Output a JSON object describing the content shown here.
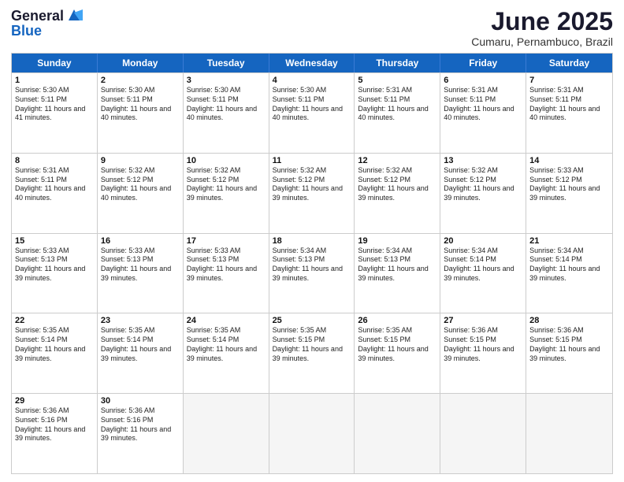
{
  "logo": {
    "text_general": "General",
    "text_blue": "Blue"
  },
  "title": "June 2025",
  "location": "Cumaru, Pernambuco, Brazil",
  "days_of_week": [
    "Sunday",
    "Monday",
    "Tuesday",
    "Wednesday",
    "Thursday",
    "Friday",
    "Saturday"
  ],
  "weeks": [
    [
      {
        "day": "1",
        "sunrise": "5:30 AM",
        "sunset": "5:11 PM",
        "daylight": "11 hours and 41 minutes."
      },
      {
        "day": "2",
        "sunrise": "5:30 AM",
        "sunset": "5:11 PM",
        "daylight": "11 hours and 40 minutes."
      },
      {
        "day": "3",
        "sunrise": "5:30 AM",
        "sunset": "5:11 PM",
        "daylight": "11 hours and 40 minutes."
      },
      {
        "day": "4",
        "sunrise": "5:30 AM",
        "sunset": "5:11 PM",
        "daylight": "11 hours and 40 minutes."
      },
      {
        "day": "5",
        "sunrise": "5:31 AM",
        "sunset": "5:11 PM",
        "daylight": "11 hours and 40 minutes."
      },
      {
        "day": "6",
        "sunrise": "5:31 AM",
        "sunset": "5:11 PM",
        "daylight": "11 hours and 40 minutes."
      },
      {
        "day": "7",
        "sunrise": "5:31 AM",
        "sunset": "5:11 PM",
        "daylight": "11 hours and 40 minutes."
      }
    ],
    [
      {
        "day": "8",
        "sunrise": "5:31 AM",
        "sunset": "5:11 PM",
        "daylight": "11 hours and 40 minutes."
      },
      {
        "day": "9",
        "sunrise": "5:32 AM",
        "sunset": "5:12 PM",
        "daylight": "11 hours and 40 minutes."
      },
      {
        "day": "10",
        "sunrise": "5:32 AM",
        "sunset": "5:12 PM",
        "daylight": "11 hours and 39 minutes."
      },
      {
        "day": "11",
        "sunrise": "5:32 AM",
        "sunset": "5:12 PM",
        "daylight": "11 hours and 39 minutes."
      },
      {
        "day": "12",
        "sunrise": "5:32 AM",
        "sunset": "5:12 PM",
        "daylight": "11 hours and 39 minutes."
      },
      {
        "day": "13",
        "sunrise": "5:32 AM",
        "sunset": "5:12 PM",
        "daylight": "11 hours and 39 minutes."
      },
      {
        "day": "14",
        "sunrise": "5:33 AM",
        "sunset": "5:12 PM",
        "daylight": "11 hours and 39 minutes."
      }
    ],
    [
      {
        "day": "15",
        "sunrise": "5:33 AM",
        "sunset": "5:13 PM",
        "daylight": "11 hours and 39 minutes."
      },
      {
        "day": "16",
        "sunrise": "5:33 AM",
        "sunset": "5:13 PM",
        "daylight": "11 hours and 39 minutes."
      },
      {
        "day": "17",
        "sunrise": "5:33 AM",
        "sunset": "5:13 PM",
        "daylight": "11 hours and 39 minutes."
      },
      {
        "day": "18",
        "sunrise": "5:34 AM",
        "sunset": "5:13 PM",
        "daylight": "11 hours and 39 minutes."
      },
      {
        "day": "19",
        "sunrise": "5:34 AM",
        "sunset": "5:13 PM",
        "daylight": "11 hours and 39 minutes."
      },
      {
        "day": "20",
        "sunrise": "5:34 AM",
        "sunset": "5:14 PM",
        "daylight": "11 hours and 39 minutes."
      },
      {
        "day": "21",
        "sunrise": "5:34 AM",
        "sunset": "5:14 PM",
        "daylight": "11 hours and 39 minutes."
      }
    ],
    [
      {
        "day": "22",
        "sunrise": "5:35 AM",
        "sunset": "5:14 PM",
        "daylight": "11 hours and 39 minutes."
      },
      {
        "day": "23",
        "sunrise": "5:35 AM",
        "sunset": "5:14 PM",
        "daylight": "11 hours and 39 minutes."
      },
      {
        "day": "24",
        "sunrise": "5:35 AM",
        "sunset": "5:14 PM",
        "daylight": "11 hours and 39 minutes."
      },
      {
        "day": "25",
        "sunrise": "5:35 AM",
        "sunset": "5:15 PM",
        "daylight": "11 hours and 39 minutes."
      },
      {
        "day": "26",
        "sunrise": "5:35 AM",
        "sunset": "5:15 PM",
        "daylight": "11 hours and 39 minutes."
      },
      {
        "day": "27",
        "sunrise": "5:36 AM",
        "sunset": "5:15 PM",
        "daylight": "11 hours and 39 minutes."
      },
      {
        "day": "28",
        "sunrise": "5:36 AM",
        "sunset": "5:15 PM",
        "daylight": "11 hours and 39 minutes."
      }
    ],
    [
      {
        "day": "29",
        "sunrise": "5:36 AM",
        "sunset": "5:16 PM",
        "daylight": "11 hours and 39 minutes."
      },
      {
        "day": "30",
        "sunrise": "5:36 AM",
        "sunset": "5:16 PM",
        "daylight": "11 hours and 39 minutes."
      },
      null,
      null,
      null,
      null,
      null
    ]
  ]
}
